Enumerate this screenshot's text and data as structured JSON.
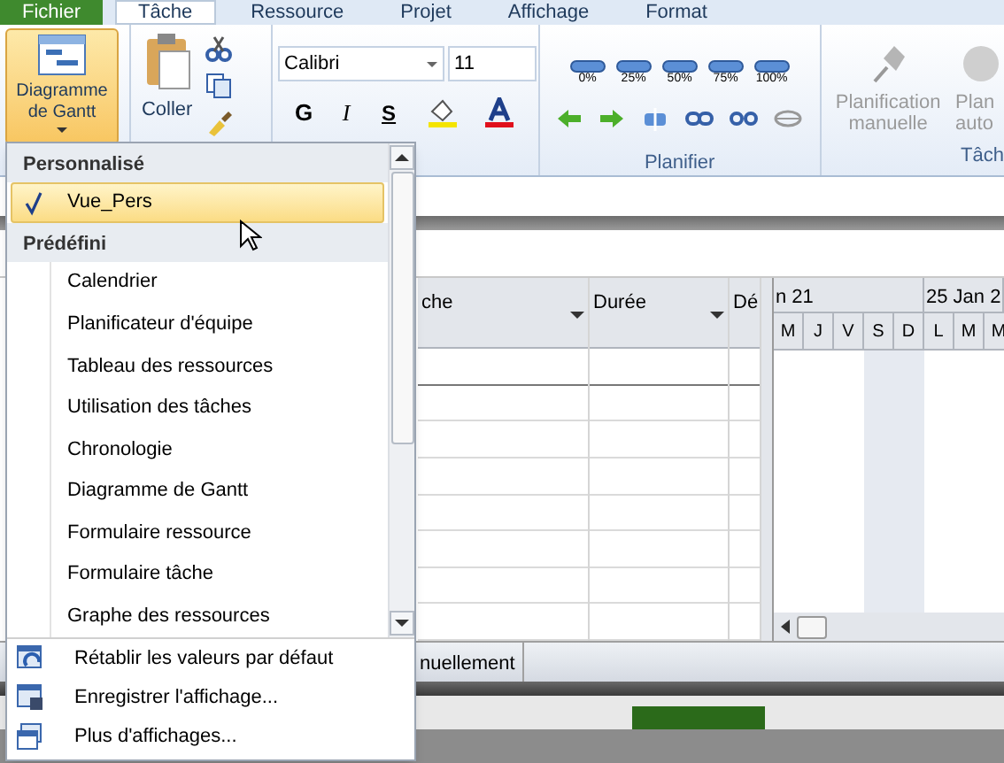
{
  "tabs": [
    {
      "label": "Fichier",
      "kind": "file",
      "selected": false
    },
    {
      "label": "Tâche",
      "kind": "tab",
      "selected": true
    },
    {
      "label": "Ressource",
      "kind": "tab",
      "selected": false
    },
    {
      "label": "Projet",
      "kind": "tab",
      "selected": false
    },
    {
      "label": "Affichage",
      "kind": "tab",
      "selected": false
    },
    {
      "label": "Format",
      "kind": "tab",
      "selected": false
    }
  ],
  "ribbon": {
    "view_button": {
      "label": "Diagramme de Gantt",
      "expanded": true
    },
    "paste": {
      "label": "Coller"
    },
    "font": {
      "name": "Calibri",
      "size": "11",
      "bold": "G",
      "italic": "I",
      "strike": "S"
    },
    "schedule": {
      "percent_buttons": [
        "0%",
        "25%",
        "50%",
        "75%",
        "100%"
      ],
      "label": "Planifier"
    },
    "manual": {
      "label": "Planification manuelle"
    },
    "auto": {
      "lines": [
        "Plan",
        "auto"
      ]
    },
    "tasks_group": {
      "label": "Tâch"
    }
  },
  "table": {
    "columns": [
      "che",
      "Durée",
      "Dé"
    ]
  },
  "timeline": {
    "weeks": [
      "n 21",
      "25 Jan 2"
    ],
    "days": [
      {
        "label": "M",
        "weekend": false
      },
      {
        "label": "J",
        "weekend": false
      },
      {
        "label": "V",
        "weekend": false
      },
      {
        "label": "S",
        "weekend": true
      },
      {
        "label": "D",
        "weekend": true
      },
      {
        "label": "L",
        "weekend": false
      },
      {
        "label": "M",
        "weekend": false
      },
      {
        "label": "M",
        "weekend": false
      }
    ]
  },
  "status_bar": {
    "text": "nuellement"
  },
  "menu": {
    "sections": [
      {
        "heading": "Personnalisé",
        "items": [
          {
            "label": "Vue_Pers",
            "checked": true,
            "selected": true
          }
        ]
      },
      {
        "heading": "Prédéfini",
        "items": [
          {
            "label": "Calendrier",
            "checked": false,
            "selected": false
          },
          {
            "label": "Planificateur d'équipe",
            "checked": false,
            "selected": false
          },
          {
            "label": "Tableau des ressources",
            "checked": false,
            "selected": false
          },
          {
            "label": "Utilisation des tâches",
            "checked": false,
            "selected": false
          },
          {
            "label": "Chronologie",
            "checked": false,
            "selected": false
          },
          {
            "label": "Diagramme de Gantt",
            "checked": false,
            "selected": false
          },
          {
            "label": "Formulaire ressource",
            "checked": false,
            "selected": false
          },
          {
            "label": "Formulaire tâche",
            "checked": false,
            "selected": false
          },
          {
            "label": "Graphe des ressources",
            "checked": false,
            "selected": false
          }
        ]
      }
    ],
    "actions": [
      {
        "label": "Rétablir les valeurs par défaut",
        "kind": "reset"
      },
      {
        "label": "Enregistrer l'affichage...",
        "kind": "save"
      },
      {
        "label": "Plus d'affichages...",
        "kind": "more"
      }
    ]
  }
}
